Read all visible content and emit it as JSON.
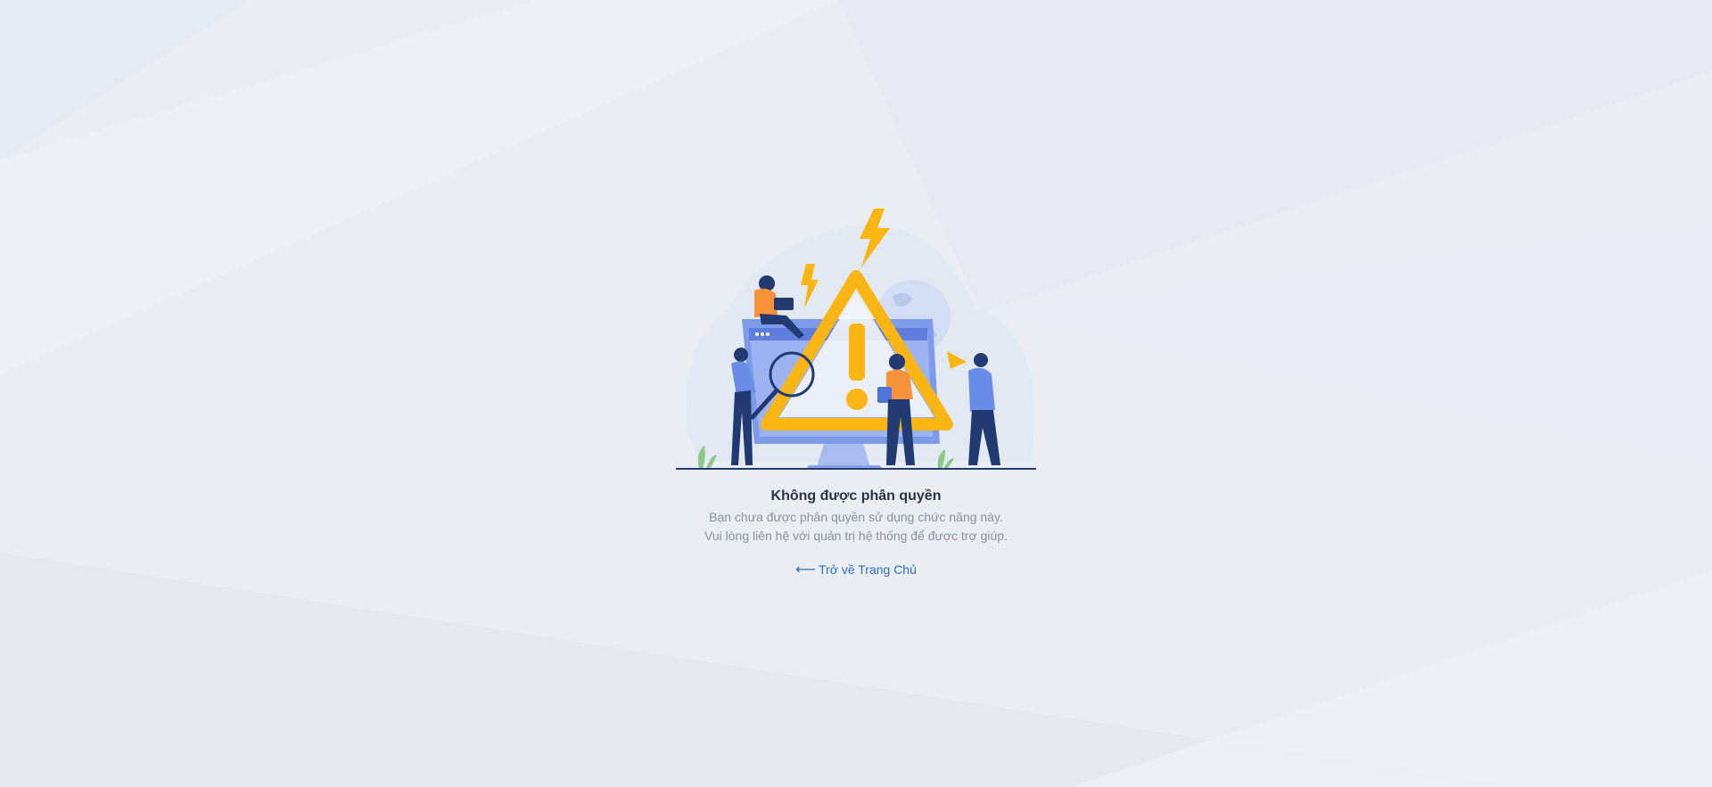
{
  "error": {
    "title": "Không được phân quyền",
    "line1": "Bạn chưa được phân quyền sử dụng chức năng này.",
    "line2": "Vui lòng liên hệ với quản trị hệ thống để được trợ giúp."
  },
  "back": {
    "arrow": "⟵",
    "label": "Trở về Trang Chủ"
  },
  "illustration": {
    "icon": "access-denied-warning-illustration",
    "accent_color": "#fbb614",
    "primary_color": "#6a8ee8",
    "dark_color": "#213a72"
  },
  "colors": {
    "background": "#eaeef3",
    "title": "#2b3340",
    "muted": "#8a929c",
    "link": "#2f6fc2"
  }
}
